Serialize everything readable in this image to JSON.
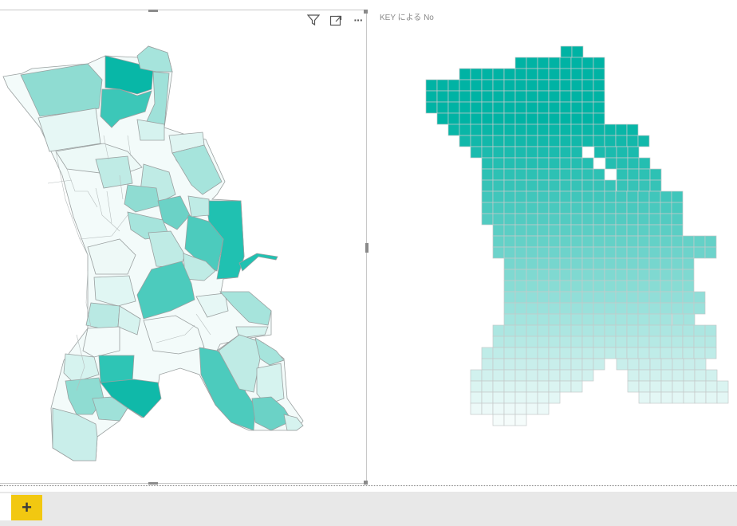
{
  "report": {
    "right_visual_title": "KEY による No",
    "header_icons": [
      "filter-icon",
      "focus-mode-icon",
      "more-options-icon"
    ],
    "more_options_glyph": "···",
    "add_page_label": "+"
  },
  "colors": {
    "accent_dark": "#00b3a4",
    "accent_light": "#e9f7f6",
    "add_page_bg": "#f2c811",
    "tab_bar_bg": "#e8e8e8"
  }
}
